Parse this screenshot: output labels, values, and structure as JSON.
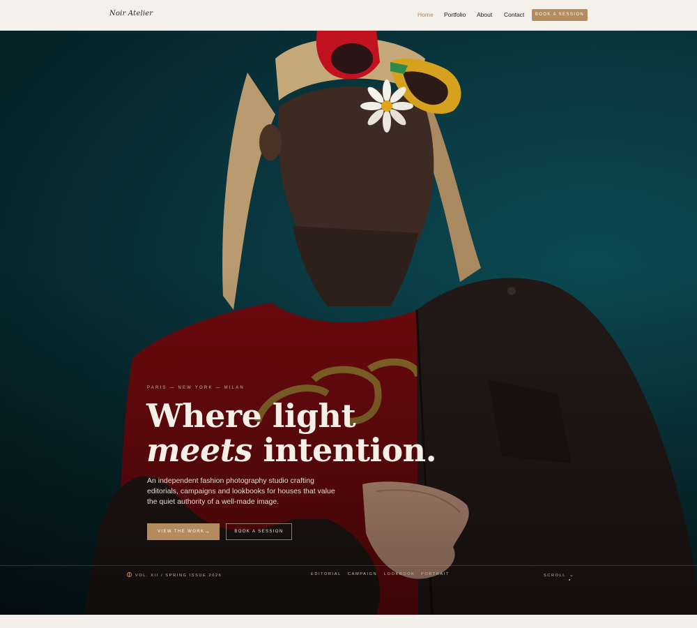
{
  "header": {
    "logo": "Noir Atelier",
    "nav": [
      "Home",
      "Portfolio",
      "About",
      "Contact"
    ],
    "active_nav": "Home",
    "cta": "BOOK A SESSION"
  },
  "hero": {
    "eyebrow": "PARIS — NEW YORK — MILAN",
    "headline_line1": "Where light",
    "headline_italic": "meets",
    "headline_rest": "intention.",
    "intro": "An independent fashion photography studio crafting editorials, campaigns and lookbooks for houses that value the quiet authority of a well-made image.",
    "primary_button": "VIEW THE WORK",
    "secondary_button": "BOOK A SESSION",
    "image": "Woman in red graphic tee, dark jacket and colourful sunglasses holding a daisy, shot from below against teal sky"
  },
  "footer_strip": {
    "issue": "VOL. XII / SPRING ISSUE 2026",
    "categories": [
      "EDITORIAL",
      "CAMPAIGN",
      "LOOKBOOK",
      "PORTRAIT"
    ],
    "scroll": "SCROLL"
  },
  "colors": {
    "accent": "#b48b5e",
    "background": "#f3efe9",
    "hero_sky": "#0a3a42",
    "shirt_red": "#7a0c10"
  },
  "icons": {
    "issue_icon": "globe-icon",
    "primary_button_icon": "arrow-right-icon",
    "scroll_icon": "chevron-down-icon"
  }
}
